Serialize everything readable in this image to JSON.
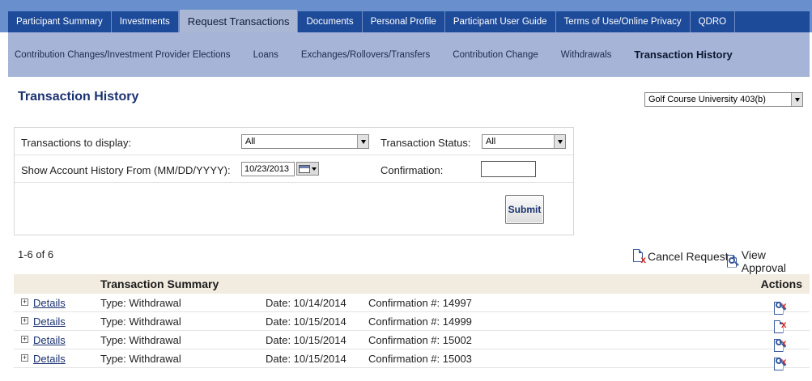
{
  "top_nav": {
    "tabs": [
      {
        "label": "Participant Summary",
        "active": false
      },
      {
        "label": "Investments",
        "active": false
      },
      {
        "label": "Request Transactions",
        "active": true
      },
      {
        "label": "Documents",
        "active": false
      },
      {
        "label": "Personal Profile",
        "active": false
      },
      {
        "label": "Participant User Guide",
        "active": false
      },
      {
        "label": "Terms of Use/Online Privacy",
        "active": false
      },
      {
        "label": "QDRO",
        "active": false
      }
    ]
  },
  "sub_nav": {
    "items": [
      {
        "label": "Contribution Changes/Investment Provider Elections",
        "active": false
      },
      {
        "label": "Loans",
        "active": false
      },
      {
        "label": "Exchanges/Rollovers/Transfers",
        "active": false
      },
      {
        "label": "Contribution Change",
        "active": false
      },
      {
        "label": "Withdrawals",
        "active": false
      },
      {
        "label": "Transaction History",
        "active": true
      }
    ]
  },
  "page": {
    "title": "Transaction History",
    "plan_select_value": "Golf Course University 403(b)"
  },
  "filters": {
    "transactions_label": "Transactions to display:",
    "transactions_value": "All",
    "status_label": "Transaction Status:",
    "status_value": "All",
    "history_from_label": "Show Account History From (MM/DD/YYYY):",
    "history_from_value": "10/23/2013",
    "confirmation_label": "Confirmation:",
    "confirmation_value": "",
    "submit_label": "Submit"
  },
  "results": {
    "count_text": "1-6 of 6",
    "legend_cancel": "Cancel Request",
    "legend_view": "View Approval"
  },
  "table": {
    "header_summary": "Transaction Summary",
    "header_actions": "Actions",
    "rows": [
      {
        "expand": "+",
        "details": "Details",
        "type": "Type: Withdrawal",
        "date": "Date: 10/14/2014",
        "confirmation": "Confirmation #: 14997",
        "actions": [
          "cancel-request-icon",
          "view-approval-icon"
        ]
      },
      {
        "expand": "+",
        "details": "Details",
        "type": "Type: Withdrawal",
        "date": "Date: 10/15/2014",
        "confirmation": "Confirmation #: 14999",
        "actions": [
          "cancel-request-icon"
        ]
      },
      {
        "expand": "+",
        "details": "Details",
        "type": "Type: Withdrawal",
        "date": "Date: 10/15/2014",
        "confirmation": "Confirmation #: 15002",
        "actions": [
          "cancel-request-icon",
          "view-approval-icon"
        ]
      },
      {
        "expand": "+",
        "details": "Details",
        "type": "Type: Withdrawal",
        "date": "Date: 10/15/2014",
        "confirmation": "Confirmation #: 15003",
        "actions": [
          "cancel-request-icon",
          "view-approval-icon"
        ]
      }
    ]
  },
  "colors": {
    "nav_dark": "#1d4a99",
    "nav_active": "#a9b7d5",
    "subnav_bg": "#a6b5d7",
    "title_blue": "#1b3270",
    "table_header_bg": "#f2ece0",
    "cancel_red": "#d8261e"
  }
}
